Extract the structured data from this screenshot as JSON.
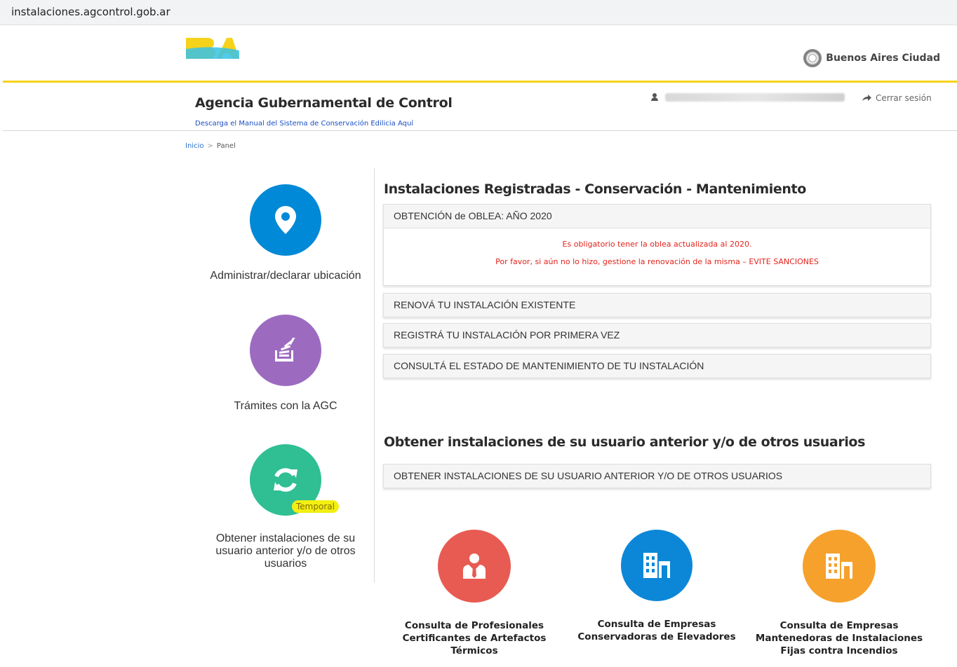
{
  "browser": {
    "url": "instalaciones.agcontrol.gob.ar"
  },
  "header": {
    "logo_alt": "BA",
    "city_name": "Buenos Aires Ciudad",
    "agency_title": "Agencia Gubernamental de Control",
    "manual_link": "Descarga el Manual del Sistema de Conservación Edilicia Aquí",
    "logout_label": "Cerrar sesión"
  },
  "breadcrumb": {
    "home": "Inicio",
    "sep": ">",
    "current": "Panel"
  },
  "sidebar": {
    "items": [
      {
        "label": "Administrar/declarar ubicación",
        "icon": "map-pin-icon",
        "color": "#0089d6"
      },
      {
        "label": "Trámites con la AGC",
        "icon": "stack-icon",
        "color": "#9c6bc0"
      },
      {
        "label": "Obtener instalaciones de su usuario anterior y/o de otros usuarios",
        "icon": "sync-icon",
        "color": "#2fbf92",
        "badge": "Temporal"
      }
    ]
  },
  "main": {
    "section1_title": "Instalaciones Registradas - Conservación - Mantenimiento",
    "notice": {
      "title": "OBTENCIÓN de OBLEA: AÑO 2020",
      "line1": "Es obligatorio tener la oblea actualizada al 2020.",
      "line2": "Por favor, si aún no lo hizo, gestione la renovación de la misma – EVITE SANCIONES"
    },
    "options": [
      "RENOVÁ TU INSTALACIÓN EXISTENTE",
      "REGISTRÁ TU INSTALACIÓN POR PRIMERA VEZ",
      "CONSULTÁ EL ESTADO DE MANTENIMIENTO DE TU INSTALACIÓN"
    ],
    "section2_title": "Obtener instalaciones de su usuario anterior y/o de otros usuarios",
    "section2_option": "OBTENER INSTALACIONES DE SU USUARIO ANTERIOR Y/O DE OTROS USUARIOS"
  },
  "bottom": {
    "items": [
      {
        "label": "Consulta de Profesionales Certificantes de Artefactos Térmicos",
        "icon": "professional-icon",
        "color": "#e85b52"
      },
      {
        "label": "Consulta de Empresas Conservadoras de Elevadores",
        "icon": "building-icon",
        "color": "#0c87d8"
      },
      {
        "label": "Consulta de Empresas Mantenedoras de Instalaciones Fijas contra Incendios",
        "icon": "building-icon",
        "color": "#f5a12c"
      }
    ]
  },
  "colors": {
    "accent_yellow": "#f6d21b",
    "alert_red": "#e2231a",
    "link_blue": "#1a4fc4"
  }
}
